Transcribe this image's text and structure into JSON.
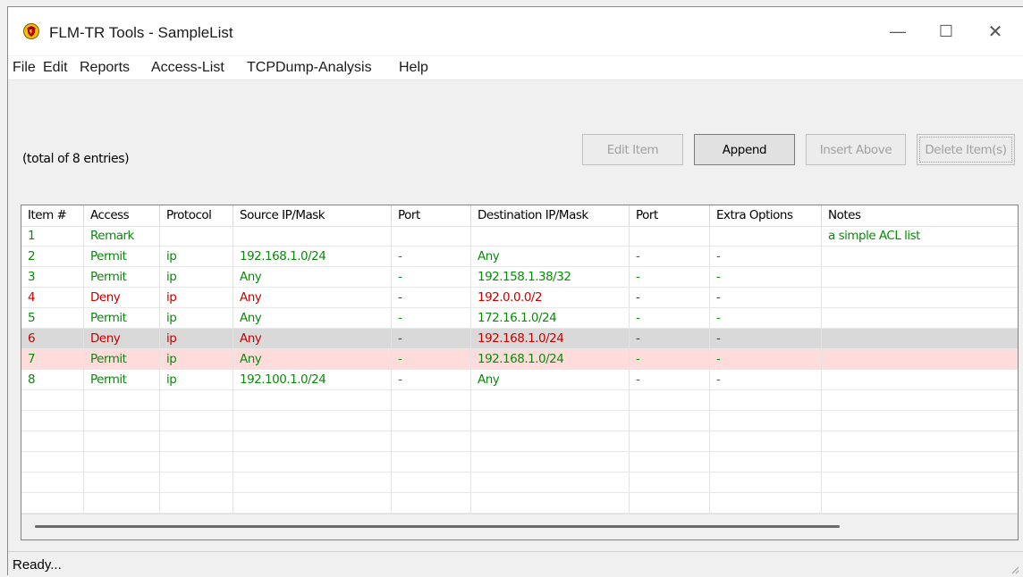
{
  "window": {
    "title": "FLM-TR Tools - SampleList",
    "controls": {
      "minimize": "—",
      "maximize": "☐",
      "close": "✕"
    }
  },
  "menu": [
    "File",
    "Edit",
    "Reports",
    "Access-List",
    "TCPDump-Analysis",
    "Help"
  ],
  "toolbar": {
    "total_label": "(total of 8 entries)",
    "edit_item": "Edit Item",
    "append": "Append",
    "insert_above": "Insert Above",
    "delete_items": "Delete Item(s)"
  },
  "table": {
    "columns": [
      "Item #",
      "Access",
      "Protocol",
      "Source IP/Mask",
      "Port",
      "Destination IP/Mask",
      "Port",
      "Extra Options",
      "Notes"
    ],
    "rows": [
      {
        "color": "green",
        "highlight": "none",
        "cells": [
          "1",
          "Remark",
          "",
          "",
          "",
          "",
          "",
          "",
          "a simple ACL list"
        ]
      },
      {
        "color": "green",
        "highlight": "none",
        "cells": [
          "2",
          "Permit",
          "ip",
          "192.168.1.0/24",
          "-",
          "Any",
          "-",
          "-",
          ""
        ]
      },
      {
        "color": "green",
        "highlight": "none",
        "cells": [
          "3",
          "Permit",
          "ip",
          "Any",
          "-",
          "192.158.1.38/32",
          "-",
          "-",
          ""
        ]
      },
      {
        "color": "red",
        "highlight": "none",
        "cells": [
          "4",
          "Deny",
          "ip",
          "Any",
          "-",
          "192.0.0.0/2",
          "-",
          "-",
          ""
        ]
      },
      {
        "color": "green",
        "highlight": "none",
        "cells": [
          "5",
          "Permit",
          "ip",
          "Any",
          "-",
          "172.16.1.0/24",
          "-",
          "-",
          ""
        ]
      },
      {
        "color": "red",
        "highlight": "gray",
        "cells": [
          "6",
          "Deny",
          "ip",
          "Any",
          "-",
          "192.168.1.0/24",
          "-",
          "-",
          ""
        ]
      },
      {
        "color": "green",
        "highlight": "pink",
        "cells": [
          "7",
          "Permit",
          "ip",
          "Any",
          "-",
          "192.168.1.0/24",
          "-",
          "-",
          ""
        ]
      },
      {
        "color": "green",
        "highlight": "none",
        "cells": [
          "8",
          "Permit",
          "ip",
          "192.100.1.0/24",
          "-",
          "Any",
          "-",
          "-",
          ""
        ]
      }
    ],
    "empty_rows": 7
  },
  "status": {
    "text": "Ready..."
  },
  "colors": {
    "permit": "#0a8a0a",
    "deny": "#c80000",
    "selected_gray": "#d9d9d9",
    "selected_pink": "#ffdcdc"
  }
}
